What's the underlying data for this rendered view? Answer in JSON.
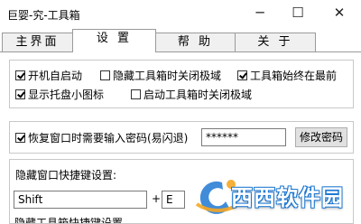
{
  "window": {
    "title": "巨婴-究-工具箱",
    "minimize": "─",
    "maximize": "☐",
    "close": "✕"
  },
  "tabs": [
    {
      "label": "主界面",
      "active": false
    },
    {
      "label": "设 置",
      "active": true
    },
    {
      "label": "帮 助",
      "active": false
    },
    {
      "label": "关 于",
      "active": false
    }
  ],
  "options": {
    "auto_start": {
      "label": "开机自启动",
      "checked": true
    },
    "hide_close_extreme": {
      "label": "隐藏工具箱时关闭极域",
      "checked": false
    },
    "always_on_top": {
      "label": "工具箱始终在最前",
      "checked": true
    },
    "tray_icon": {
      "label": "显示托盘小图标",
      "checked": true
    },
    "start_close_extreme": {
      "label": "启动工具箱时关闭极域",
      "checked": false
    }
  },
  "password": {
    "label": "恢复窗口时需要输入密码(易闪退)",
    "checked": true,
    "value": "******",
    "change_button": "修改密码"
  },
  "hotkey": {
    "label": "隐藏窗口快捷键设置:",
    "modifier": "Shift",
    "plus": "+",
    "key": "E"
  },
  "cut_label": "隐藏工具箱快捷键设置",
  "watermark": {
    "text": "西西软件园"
  },
  "colors": {
    "accent": "#1e78d2",
    "watermark_orange": "#f5a623"
  }
}
